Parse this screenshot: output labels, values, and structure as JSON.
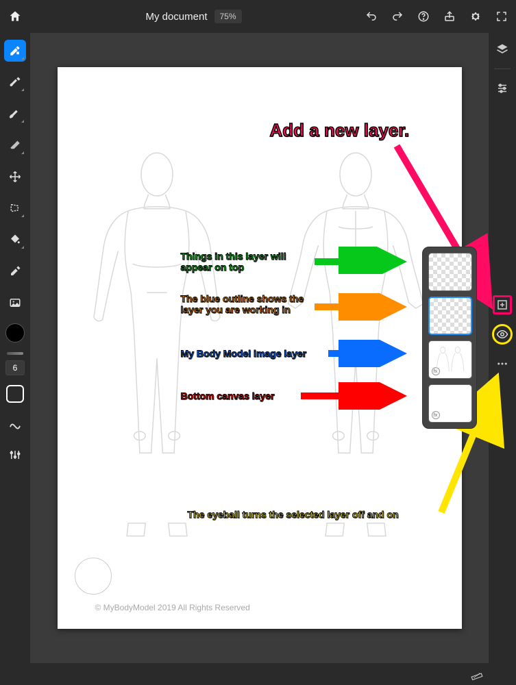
{
  "header": {
    "title": "My document",
    "zoom": "75%"
  },
  "left_tools": {
    "brush_size_value": "6"
  },
  "annotations": {
    "add_layer": "Add a new layer.",
    "top_layer": "Things in this layer will appear on top",
    "working_layer": "The blue outline shows the layer you are working in",
    "body_layer": "My Body Model image layer",
    "bottom_layer": "Bottom canvas layer",
    "eyeball": "The eyeball turns the selected layer off and on"
  },
  "canvas": {
    "copyright": "© MyBodyModel 2019 All Rights Reserved",
    "fx_badge": "fx"
  },
  "colors": {
    "pink": "#ff0b64",
    "green": "#05c81a",
    "orange": "#ff8d00",
    "blue": "#0a6cff",
    "red": "#ff0000",
    "yellow": "#ffe600"
  },
  "layers_panel": {
    "count": 4,
    "selected_index": 1
  }
}
